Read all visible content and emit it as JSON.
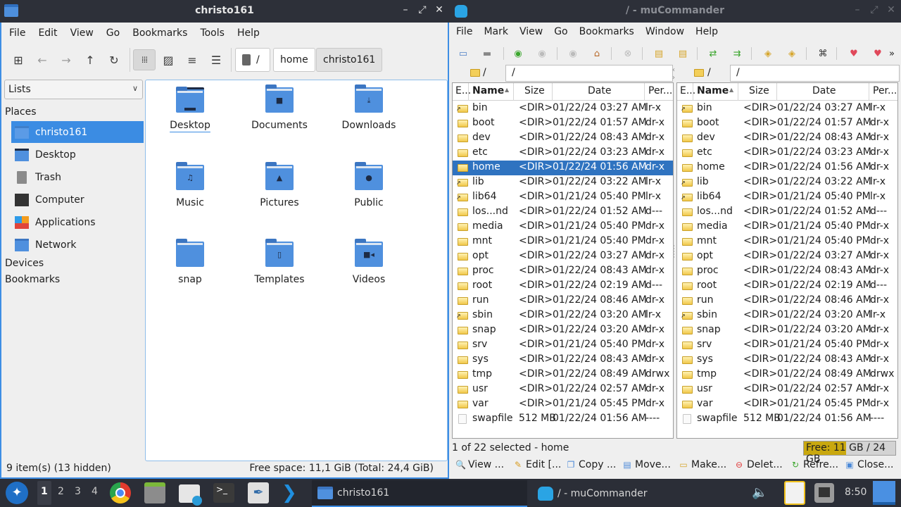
{
  "file_manager": {
    "title": "christo161",
    "window_buttons": [
      "–",
      "⤢",
      "✕"
    ],
    "menu": [
      "File",
      "Edit",
      "View",
      "Go",
      "Bookmarks",
      "Tools",
      "Help"
    ],
    "breadcrumb": [
      "/",
      "home",
      "christo161"
    ],
    "sidebar_mode": "Lists",
    "sections": {
      "places": "Places",
      "devices": "Devices",
      "bookmarks": "Bookmarks"
    },
    "places": [
      {
        "label": "christo161",
        "icon": "home-folder-icon",
        "selected": true
      },
      {
        "label": "Desktop",
        "icon": "desktop-icon"
      },
      {
        "label": "Trash",
        "icon": "trash-icon"
      },
      {
        "label": "Computer",
        "icon": "computer-icon"
      },
      {
        "label": "Applications",
        "icon": "applications-icon"
      },
      {
        "label": "Network",
        "icon": "network-icon"
      }
    ],
    "items": [
      {
        "label": "Desktop",
        "glyph": "desktop"
      },
      {
        "label": "Documents",
        "glyph": "■"
      },
      {
        "label": "Downloads",
        "glyph": "⤓"
      },
      {
        "label": "Music",
        "glyph": "♫"
      },
      {
        "label": "Pictures",
        "glyph": "▲"
      },
      {
        "label": "Public",
        "glyph": "●"
      },
      {
        "label": "snap",
        "glyph": ""
      },
      {
        "label": "Templates",
        "glyph": "▯"
      },
      {
        "label": "Videos",
        "glyph": "■◂"
      }
    ],
    "status_left": "9 item(s) (13 hidden)",
    "status_right": "Free space: 11,1 GiB (Total: 24,4 GiB)"
  },
  "mucommander": {
    "title": "/ - muCommander",
    "window_buttons": [
      "–",
      "⤢",
      "✕"
    ],
    "menu": [
      "File",
      "Mark",
      "View",
      "Go",
      "Bookmarks",
      "Window",
      "Help"
    ],
    "left_location": {
      "root": "/",
      "path": "/"
    },
    "right_location": {
      "root": "/",
      "path": "/"
    },
    "columns": [
      "E...",
      "Name",
      "Size",
      "Date",
      "Per..."
    ],
    "left_rows": [
      {
        "name": "bin",
        "size": "<DIR>",
        "date": "01/22/24 03:27 AM",
        "perm": "lr-x",
        "link": true
      },
      {
        "name": "boot",
        "size": "<DIR>",
        "date": "01/22/24 01:57 AM",
        "perm": "dr-x"
      },
      {
        "name": "dev",
        "size": "<DIR>",
        "date": "01/22/24 08:43 AM",
        "perm": "dr-x"
      },
      {
        "name": "etc",
        "size": "<DIR>",
        "date": "01/22/24 03:23 AM",
        "perm": "dr-x"
      },
      {
        "name": "home",
        "size": "<DIR>",
        "date": "01/22/24 01:56 AM",
        "perm": "dr-x",
        "selected": true
      },
      {
        "name": "lib",
        "size": "<DIR>",
        "date": "01/22/24 03:22 AM",
        "perm": "lr-x",
        "link": true
      },
      {
        "name": "lib64",
        "size": "<DIR>",
        "date": "01/21/24 05:40 PM",
        "perm": "lr-x",
        "link": true
      },
      {
        "name": "los...nd",
        "size": "<DIR>",
        "date": "01/22/24 01:52 AM",
        "perm": "d---"
      },
      {
        "name": "media",
        "size": "<DIR>",
        "date": "01/21/24 05:40 PM",
        "perm": "dr-x"
      },
      {
        "name": "mnt",
        "size": "<DIR>",
        "date": "01/21/24 05:40 PM",
        "perm": "dr-x"
      },
      {
        "name": "opt",
        "size": "<DIR>",
        "date": "01/22/24 03:27 AM",
        "perm": "dr-x"
      },
      {
        "name": "proc",
        "size": "<DIR>",
        "date": "01/22/24 08:43 AM",
        "perm": "dr-x"
      },
      {
        "name": "root",
        "size": "<DIR>",
        "date": "01/22/24 02:19 AM",
        "perm": "d---"
      },
      {
        "name": "run",
        "size": "<DIR>",
        "date": "01/22/24 08:46 AM",
        "perm": "dr-x"
      },
      {
        "name": "sbin",
        "size": "<DIR>",
        "date": "01/22/24 03:20 AM",
        "perm": "lr-x",
        "link": true
      },
      {
        "name": "snap",
        "size": "<DIR>",
        "date": "01/22/24 03:20 AM",
        "perm": "dr-x"
      },
      {
        "name": "srv",
        "size": "<DIR>",
        "date": "01/21/24 05:40 PM",
        "perm": "dr-x"
      },
      {
        "name": "sys",
        "size": "<DIR>",
        "date": "01/22/24 08:43 AM",
        "perm": "dr-x"
      },
      {
        "name": "tmp",
        "size": "<DIR>",
        "date": "01/22/24 08:49 AM",
        "perm": "drwx"
      },
      {
        "name": "usr",
        "size": "<DIR>",
        "date": "01/22/24 02:57 AM",
        "perm": "dr-x"
      },
      {
        "name": "var",
        "size": "<DIR>",
        "date": "01/21/24 05:45 PM",
        "perm": "dr-x"
      },
      {
        "name": "swapfile",
        "size": "512 MB",
        "date": "01/22/24 01:56 AM",
        "perm": "----",
        "file": true
      }
    ],
    "right_rows": [
      {
        "name": "bin",
        "size": "<DIR>",
        "date": "01/22/24 03:27 AM",
        "perm": "lr-x",
        "link": true
      },
      {
        "name": "boot",
        "size": "<DIR>",
        "date": "01/22/24 01:57 AM",
        "perm": "dr-x"
      },
      {
        "name": "dev",
        "size": "<DIR>",
        "date": "01/22/24 08:43 AM",
        "perm": "dr-x"
      },
      {
        "name": "etc",
        "size": "<DIR>",
        "date": "01/22/24 03:23 AM",
        "perm": "dr-x"
      },
      {
        "name": "home",
        "size": "<DIR>",
        "date": "01/22/24 01:56 AM",
        "perm": "dr-x"
      },
      {
        "name": "lib",
        "size": "<DIR>",
        "date": "01/22/24 03:22 AM",
        "perm": "lr-x",
        "link": true
      },
      {
        "name": "lib64",
        "size": "<DIR>",
        "date": "01/21/24 05:40 PM",
        "perm": "lr-x",
        "link": true
      },
      {
        "name": "los...nd",
        "size": "<DIR>",
        "date": "01/22/24 01:52 AM",
        "perm": "d---"
      },
      {
        "name": "media",
        "size": "<DIR>",
        "date": "01/21/24 05:40 PM",
        "perm": "dr-x"
      },
      {
        "name": "mnt",
        "size": "<DIR>",
        "date": "01/21/24 05:40 PM",
        "perm": "dr-x"
      },
      {
        "name": "opt",
        "size": "<DIR>",
        "date": "01/22/24 03:27 AM",
        "perm": "dr-x"
      },
      {
        "name": "proc",
        "size": "<DIR>",
        "date": "01/22/24 08:43 AM",
        "perm": "dr-x"
      },
      {
        "name": "root",
        "size": "<DIR>",
        "date": "01/22/24 02:19 AM",
        "perm": "d---"
      },
      {
        "name": "run",
        "size": "<DIR>",
        "date": "01/22/24 08:46 AM",
        "perm": "dr-x"
      },
      {
        "name": "sbin",
        "size": "<DIR>",
        "date": "01/22/24 03:20 AM",
        "perm": "lr-x",
        "link": true
      },
      {
        "name": "snap",
        "size": "<DIR>",
        "date": "01/22/24 03:20 AM",
        "perm": "dr-x"
      },
      {
        "name": "srv",
        "size": "<DIR>",
        "date": "01/21/24 05:40 PM",
        "perm": "dr-x"
      },
      {
        "name": "sys",
        "size": "<DIR>",
        "date": "01/22/24 08:43 AM",
        "perm": "dr-x"
      },
      {
        "name": "tmp",
        "size": "<DIR>",
        "date": "01/22/24 08:49 AM",
        "perm": "drwx"
      },
      {
        "name": "usr",
        "size": "<DIR>",
        "date": "01/22/24 02:57 AM",
        "perm": "dr-x"
      },
      {
        "name": "var",
        "size": "<DIR>",
        "date": "01/21/24 05:45 PM",
        "perm": "dr-x"
      },
      {
        "name": "swapfile",
        "size": "512 MB",
        "date": "01/22/24 01:56 AM",
        "perm": "----",
        "file": true
      }
    ],
    "status": "1 of 22 selected - home",
    "free_space": {
      "text": "Free: 11 GB / 24 GB",
      "used_fraction": 0.46,
      "fill_color": "#c9a80f"
    },
    "commands": [
      {
        "label": "View ...",
        "icon": "view-icon",
        "glyph": "🔍"
      },
      {
        "label": "Edit [...",
        "icon": "edit-icon",
        "glyph": "✎"
      },
      {
        "label": "Copy ...",
        "icon": "copy-icon",
        "glyph": "❐"
      },
      {
        "label": "Move...",
        "icon": "move-icon",
        "glyph": "▤"
      },
      {
        "label": "Make...",
        "icon": "make-folder-icon",
        "glyph": "▭"
      },
      {
        "label": "Delet...",
        "icon": "delete-icon",
        "glyph": "⊖"
      },
      {
        "label": "Refre...",
        "icon": "refresh-icon",
        "glyph": "↻"
      },
      {
        "label": "Close...",
        "icon": "close-window-icon",
        "glyph": "▣"
      }
    ]
  },
  "taskbar": {
    "workspaces": [
      "1",
      "2",
      "3",
      "4"
    ],
    "active_workspace": "1",
    "tasks": [
      {
        "label": "christo161",
        "active": true
      },
      {
        "label": "/ - muCommander"
      }
    ],
    "clock": "8:50"
  }
}
